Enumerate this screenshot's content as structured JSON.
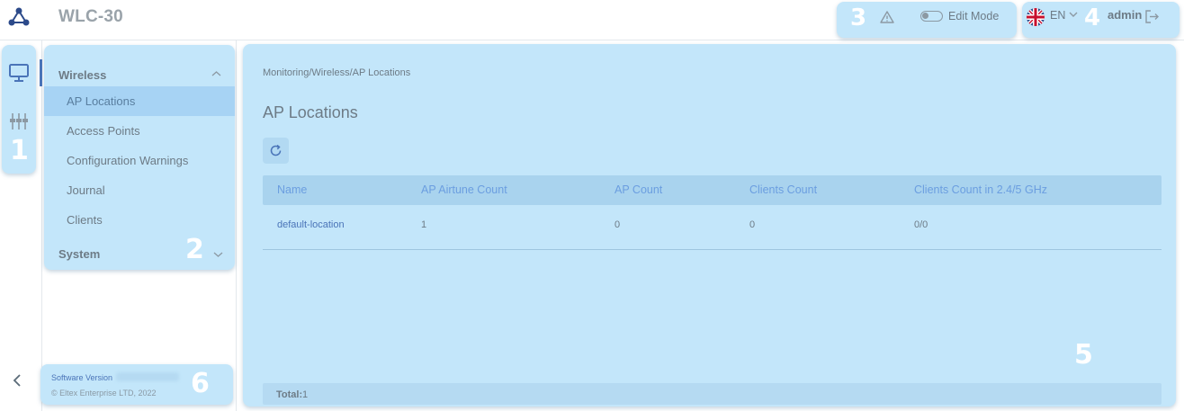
{
  "app": {
    "title": "WLC-30"
  },
  "header": {
    "edit_mode_label": "Edit Mode",
    "edit_mode_on": false,
    "language": "EN",
    "user": "admin",
    "icons": [
      "logo-icon",
      "warning-icon",
      "uk-flag-icon",
      "chevron-down-icon",
      "logout-icon"
    ]
  },
  "rail": {
    "icons": [
      "monitor-icon",
      "settings-icon",
      "chevron-left-icon"
    ]
  },
  "sidebar": {
    "groups": [
      {
        "label": "Wireless",
        "expanded": true,
        "items": [
          {
            "label": "AP Locations",
            "active": true
          },
          {
            "label": "Access Points",
            "active": false
          },
          {
            "label": "Configuration Warnings",
            "active": false
          },
          {
            "label": "Journal",
            "active": false
          },
          {
            "label": "Clients",
            "active": false
          }
        ]
      },
      {
        "label": "System",
        "expanded": false
      }
    ],
    "software_version_label": "Software Version",
    "copyright": "© Eltex Enterprise LTD, 2022"
  },
  "main": {
    "breadcrumb": "Monitoring/Wireless/AP Locations",
    "title": "AP Locations",
    "table": {
      "columns": [
        "Name",
        "AP Airtune Count",
        "AP Count",
        "Clients Count",
        "Clients Count in 2.4/5 GHz"
      ],
      "rows": [
        [
          "default-location",
          "1",
          "0",
          "0",
          "0/0"
        ]
      ]
    },
    "total_label": "Total:",
    "total_value": "1"
  },
  "annotations": {
    "badges": [
      "1",
      "2",
      "3",
      "4",
      "5",
      "6"
    ]
  },
  "colors": {
    "highlight": "#c3e6fa",
    "active_item": "#a7d3f4",
    "table_header": "#a9d3ee",
    "link": "#4a74b8",
    "header_text": "#6b9ee0",
    "brand": "#2c4a8a"
  }
}
